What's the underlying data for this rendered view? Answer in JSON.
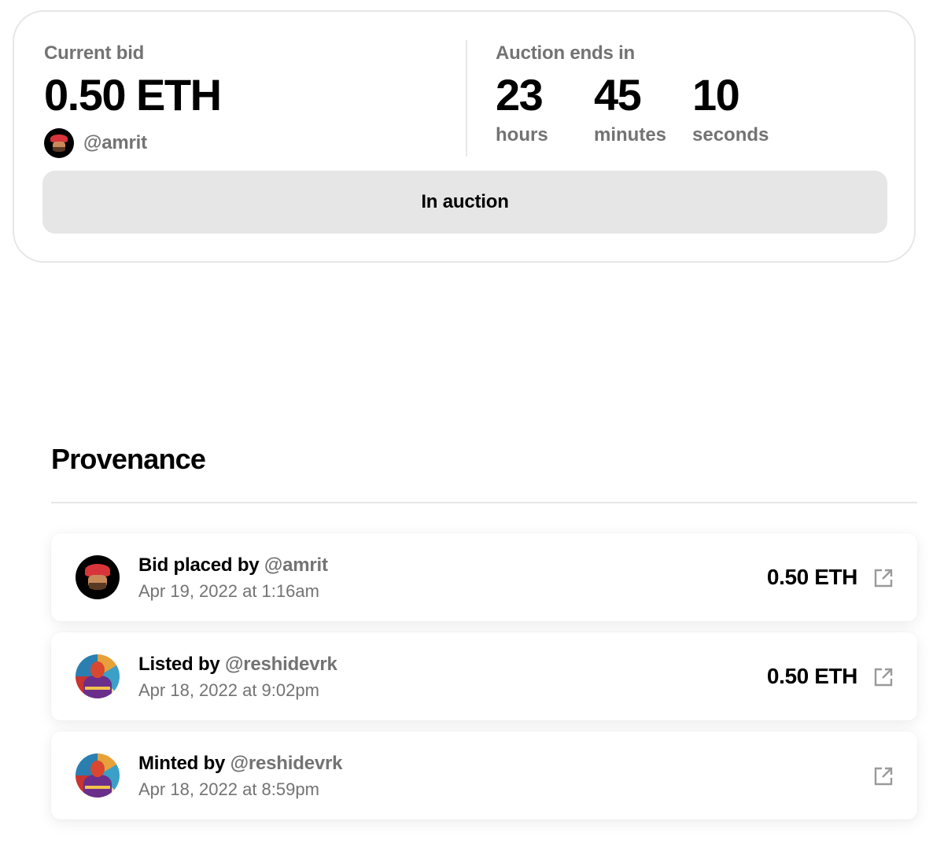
{
  "auction": {
    "current_bid_label": "Current bid",
    "current_bid_value": "0.50 ETH",
    "bidder_handle": "@amrit",
    "ends_label": "Auction ends in",
    "timer": [
      {
        "value": "23",
        "unit": "hours"
      },
      {
        "value": "45",
        "unit": "minutes"
      },
      {
        "value": "10",
        "unit": "seconds"
      }
    ],
    "status_button_label": "In auction"
  },
  "provenance": {
    "title": "Provenance",
    "events": [
      {
        "label": "Bid placed by",
        "handle": "@amrit",
        "date": "Apr 19, 2022 at 1:16am",
        "amount": "0.50 ETH",
        "avatar": "amrit-avatar",
        "icon": "external-link-icon"
      },
      {
        "label": "Listed by",
        "handle": "@reshidevrk",
        "date": "Apr 18, 2022 at 9:02pm",
        "amount": "0.50 ETH",
        "avatar": "reshidevrk-avatar",
        "icon": "external-link-icon"
      },
      {
        "label": "Minted by",
        "handle": "@reshidevrk",
        "date": "Apr 18, 2022 at 8:59pm",
        "amount": "",
        "avatar": "reshidevrk-avatar",
        "icon": "external-link-icon"
      }
    ]
  },
  "colors": {
    "muted_text": "#737373",
    "border": "#e6e6e6",
    "button_bg": "#e6e6e6",
    "text": "#000000"
  }
}
